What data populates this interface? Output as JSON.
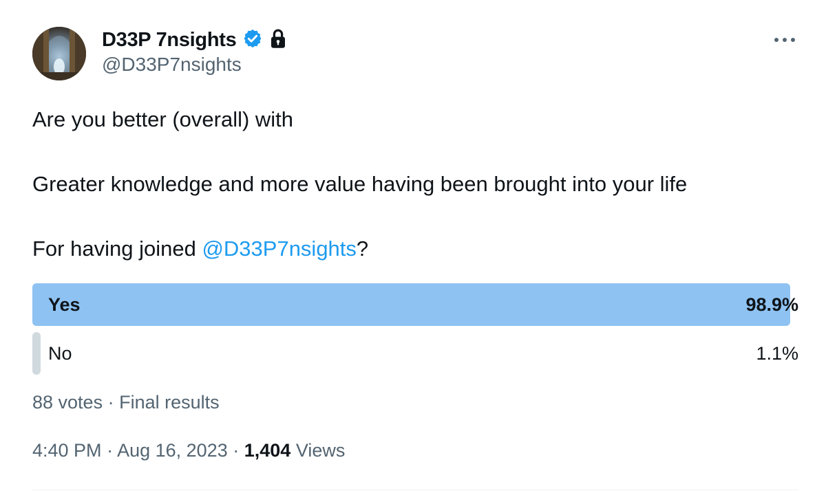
{
  "author": {
    "display_name": "D33P 7nsights",
    "handle": "@D33P7nsights",
    "verified": true,
    "protected": true,
    "avatar_icon": "cathedral-avatar-icon"
  },
  "tweet": {
    "line1": "Are you better (overall) with",
    "line2": "Greater knowledge and more value having been brought into your life",
    "line3_prefix": "For having joined ",
    "line3_mention": "@D33P7nsights",
    "line3_suffix": "?"
  },
  "poll": {
    "options": [
      {
        "label": "Yes",
        "percent": "98.9%",
        "fraction": 0.989,
        "winner": true
      },
      {
        "label": "No",
        "percent": "1.1%",
        "fraction": 0.011,
        "winner": false
      }
    ],
    "votes": "88 votes",
    "separator": " · ",
    "status": "Final results"
  },
  "meta": {
    "time": "4:40 PM",
    "separator": " · ",
    "date": "Aug 16, 2023",
    "views_count": "1,404",
    "views_label": " Views"
  },
  "colors": {
    "winner_bar": "#8ec2f2",
    "loser_bar": "#cfd9de",
    "accent": "#1d9bf0",
    "text": "#0f1419",
    "secondary_text": "#536471"
  },
  "icons": {
    "more": "more-options-icon",
    "verified": "verified-badge-icon",
    "lock": "lock-icon"
  }
}
